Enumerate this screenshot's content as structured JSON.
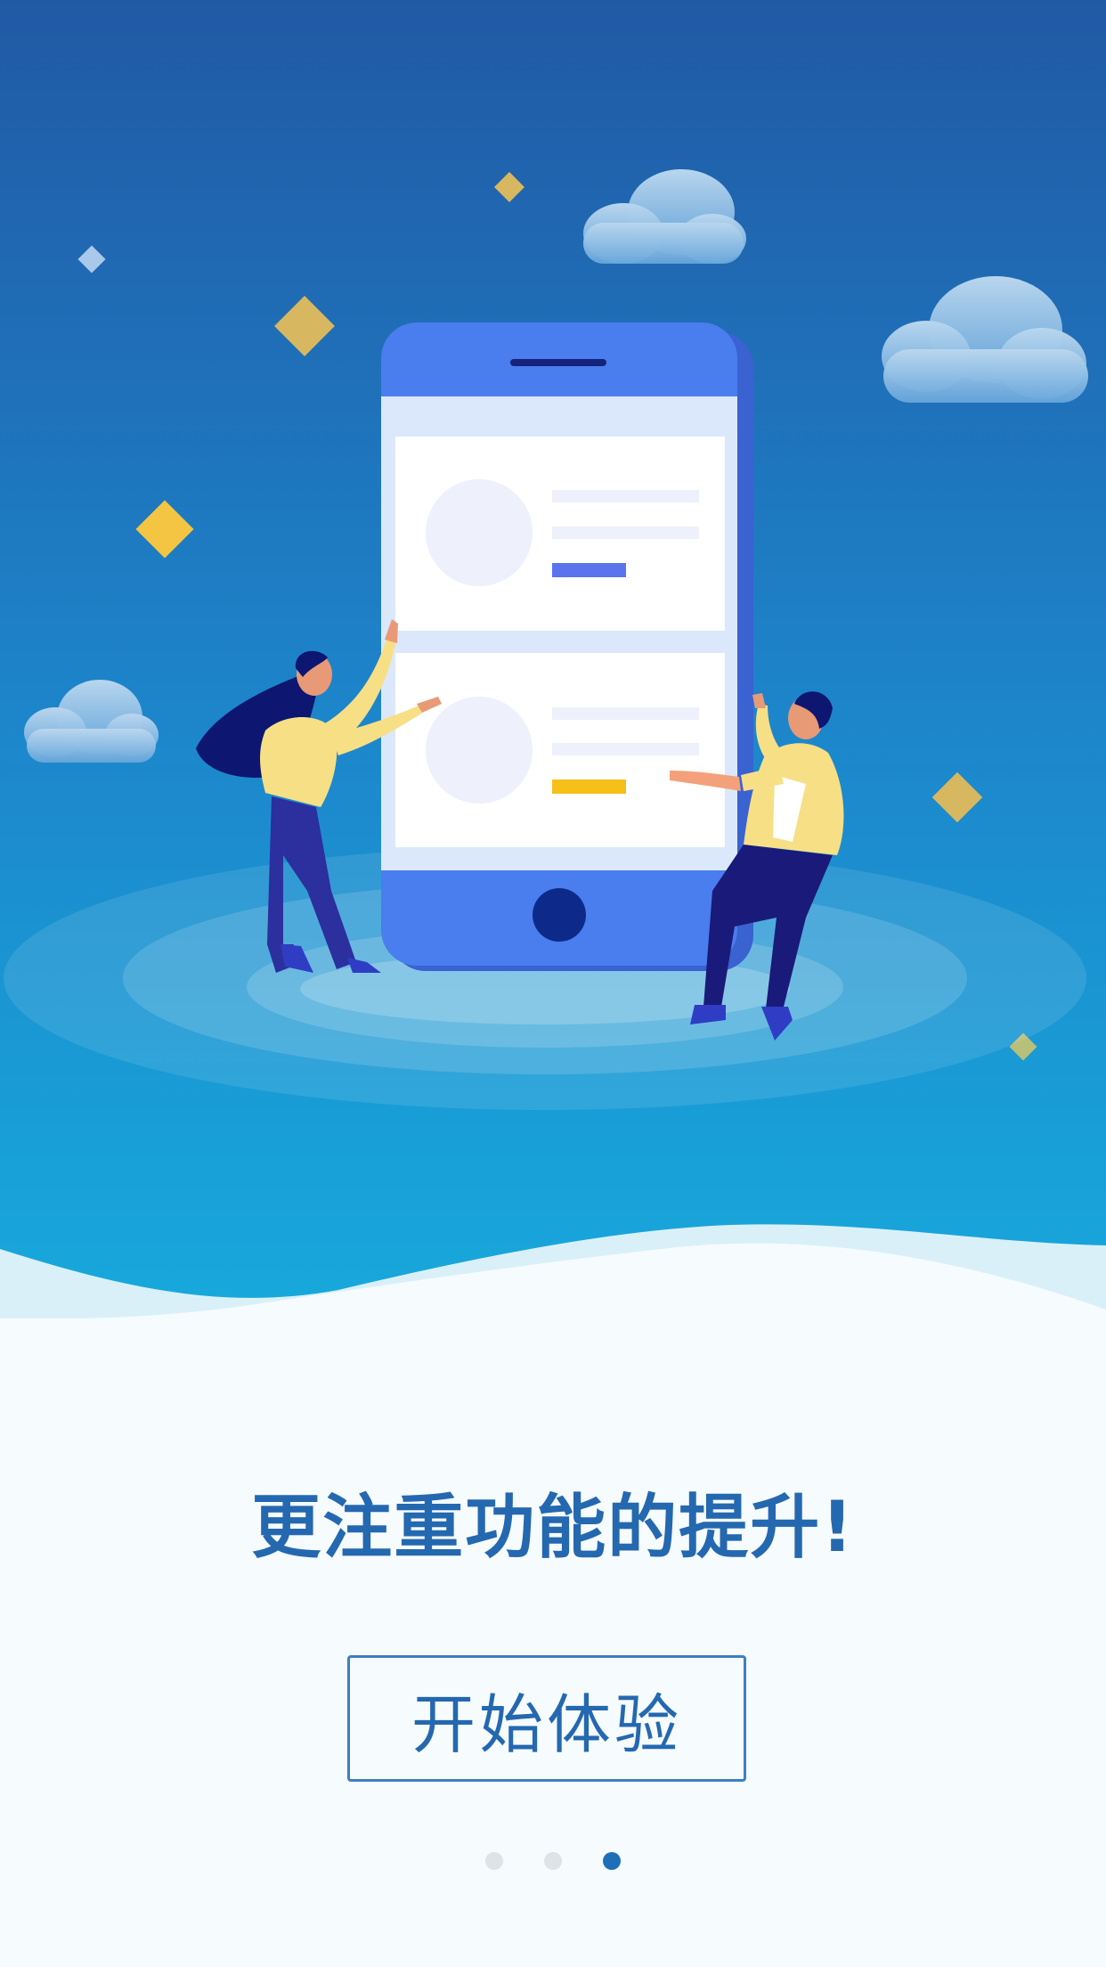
{
  "headline": "更注重功能的提升!",
  "start_button_label": "开始体验",
  "pager": {
    "page_count": 3,
    "current_page": 3
  },
  "colors": {
    "sky_top": "#2159a5",
    "sky_bottom": "#17a6d9",
    "phone_body": "#4a7ded",
    "accent_gold": "#d7b75f",
    "headline": "#2468b0",
    "dot_active": "#1f6fb8",
    "dot_inactive": "#dfe3e8"
  }
}
